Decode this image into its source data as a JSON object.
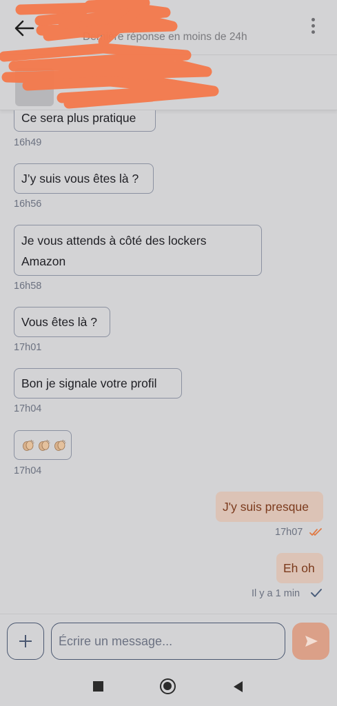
{
  "header": {
    "status_text": "Dernière réponse en moins de 24h"
  },
  "messages": [
    {
      "text": "Ce sera plus pratique",
      "time": "16h49",
      "direction": "in"
    },
    {
      "text": "J’y suis vous êtes là ?",
      "time": "16h56",
      "direction": "in"
    },
    {
      "text": "Je vous attends à côté des lockers Amazon",
      "time": "16h58",
      "direction": "in"
    },
    {
      "text": "Vous êtes là ?",
      "time": "17h01",
      "direction": "in"
    },
    {
      "text": "Bon je signale votre profil",
      "time": "17h04",
      "direction": "in"
    },
    {
      "text": "👏🏼👏🏼👏🏼",
      "time": "17h04",
      "direction": "in"
    },
    {
      "text": "J'y suis presque",
      "time": "17h07",
      "direction": "out",
      "status": "read"
    },
    {
      "text": "Eh oh",
      "time": "Il y a 1 min",
      "direction": "out",
      "status": "sent"
    }
  ],
  "composer": {
    "placeholder": "Écrire un message..."
  },
  "icons": {
    "back": "arrow-left-icon",
    "menu": "more-vertical-icon",
    "attach": "plus-icon",
    "send": "send-icon",
    "read": "double-check-icon",
    "sent": "check-icon"
  },
  "colors": {
    "background": "#d3d3d5",
    "outgoing_bubble": "#dcc3b6",
    "outgoing_text": "#7b3a1c",
    "accent": "#dba088",
    "read_tick": "#e07a45",
    "sent_tick": "#4a5d7a"
  }
}
